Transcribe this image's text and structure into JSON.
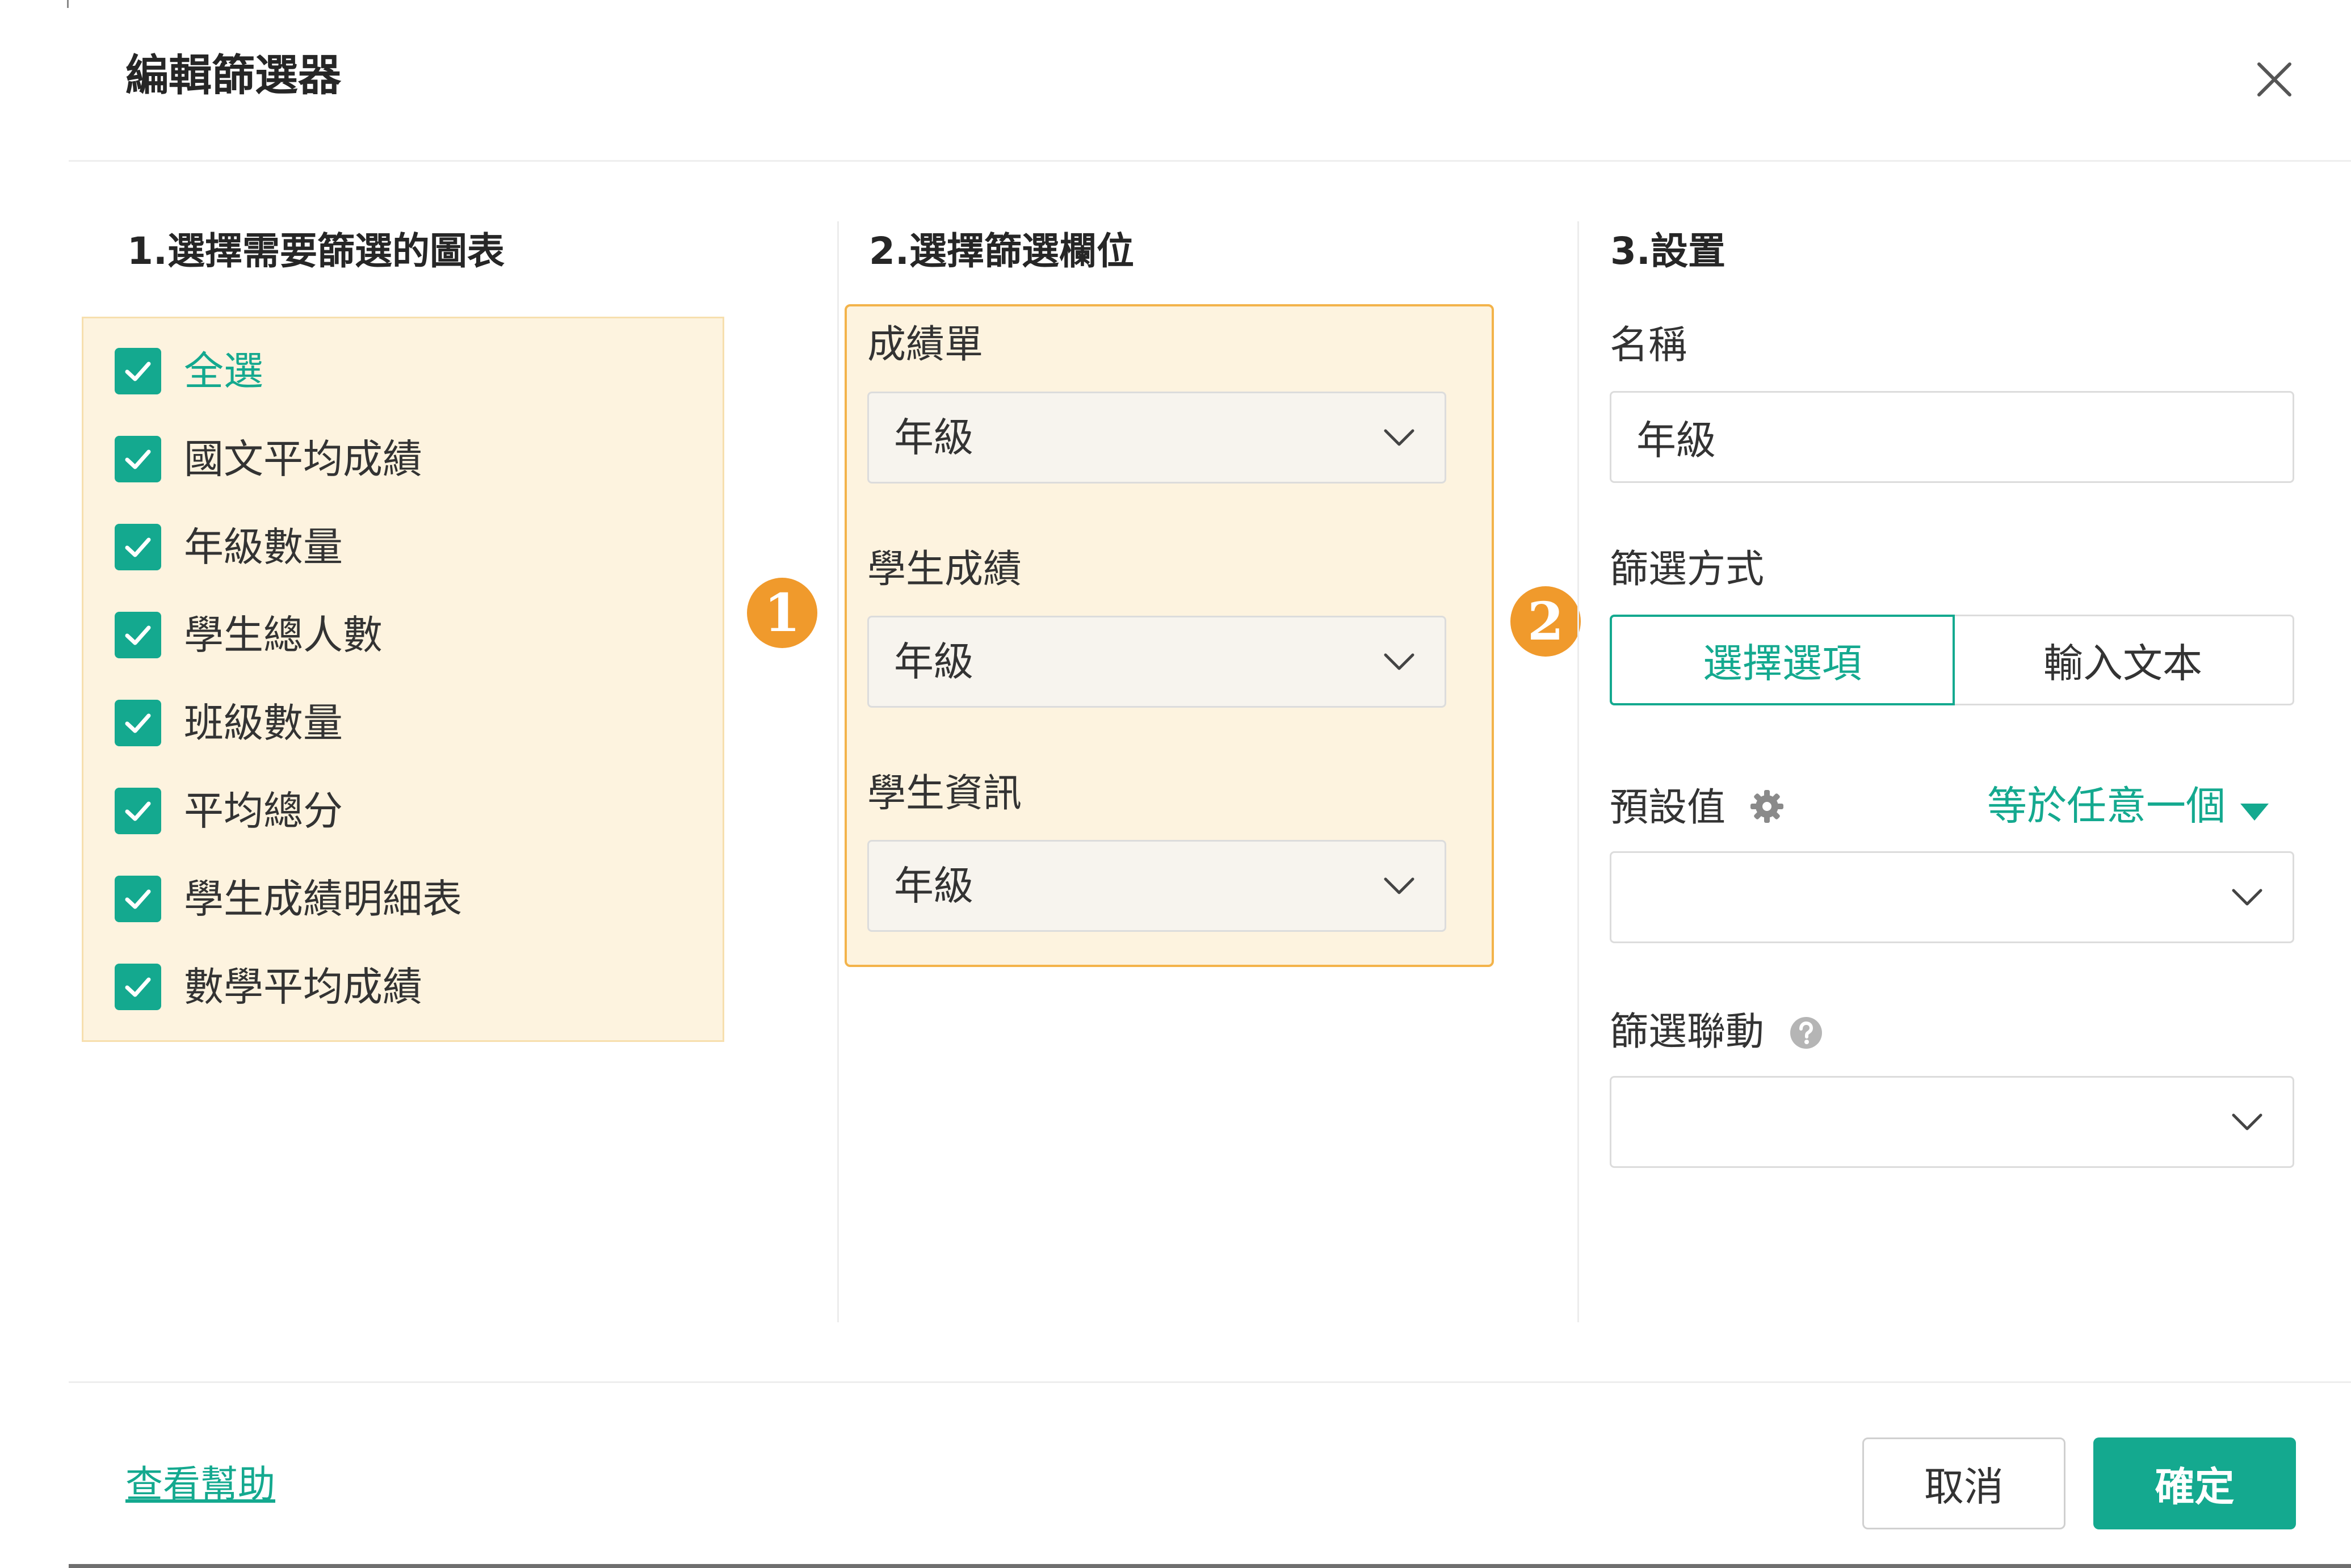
{
  "dialog": {
    "title": "編輯篩選器",
    "close_icon": "close-icon"
  },
  "column1": {
    "title": "1.選擇需要篩選的圖表",
    "items": [
      {
        "label": "全選",
        "checked": true,
        "accent": true
      },
      {
        "label": "國文平均成績",
        "checked": true
      },
      {
        "label": "年級數量",
        "checked": true
      },
      {
        "label": "學生總人數",
        "checked": true
      },
      {
        "label": "班級數量",
        "checked": true
      },
      {
        "label": "平均總分",
        "checked": true
      },
      {
        "label": "學生成績明細表",
        "checked": true
      },
      {
        "label": "數學平均成績",
        "checked": true
      }
    ]
  },
  "column2": {
    "title": "2.選擇篩選欄位",
    "fields": [
      {
        "label": "成績單",
        "value": "年級"
      },
      {
        "label": "學生成績",
        "value": "年級"
      },
      {
        "label": "學生資訊",
        "value": "年級"
      }
    ]
  },
  "badges": {
    "first": "1",
    "second": "2"
  },
  "column3": {
    "title": "3.設置",
    "name_label": "名稱",
    "name_value": "年級",
    "mode_label": "篩選方式",
    "mode_options": [
      "選擇選項",
      "輸入文本"
    ],
    "mode_selected": "選擇選項",
    "default_label": "預設值",
    "default_operator": "等於任意一個",
    "default_value": "",
    "link_label": "篩選聯動",
    "link_value": ""
  },
  "footer": {
    "help": "查看幫助",
    "cancel": "取消",
    "confirm": "確定"
  },
  "colors": {
    "accent": "#14a98f",
    "highlight_bg": "#fdf3df",
    "highlight_border": "#f3b34a",
    "badge": "#f09a2c"
  }
}
